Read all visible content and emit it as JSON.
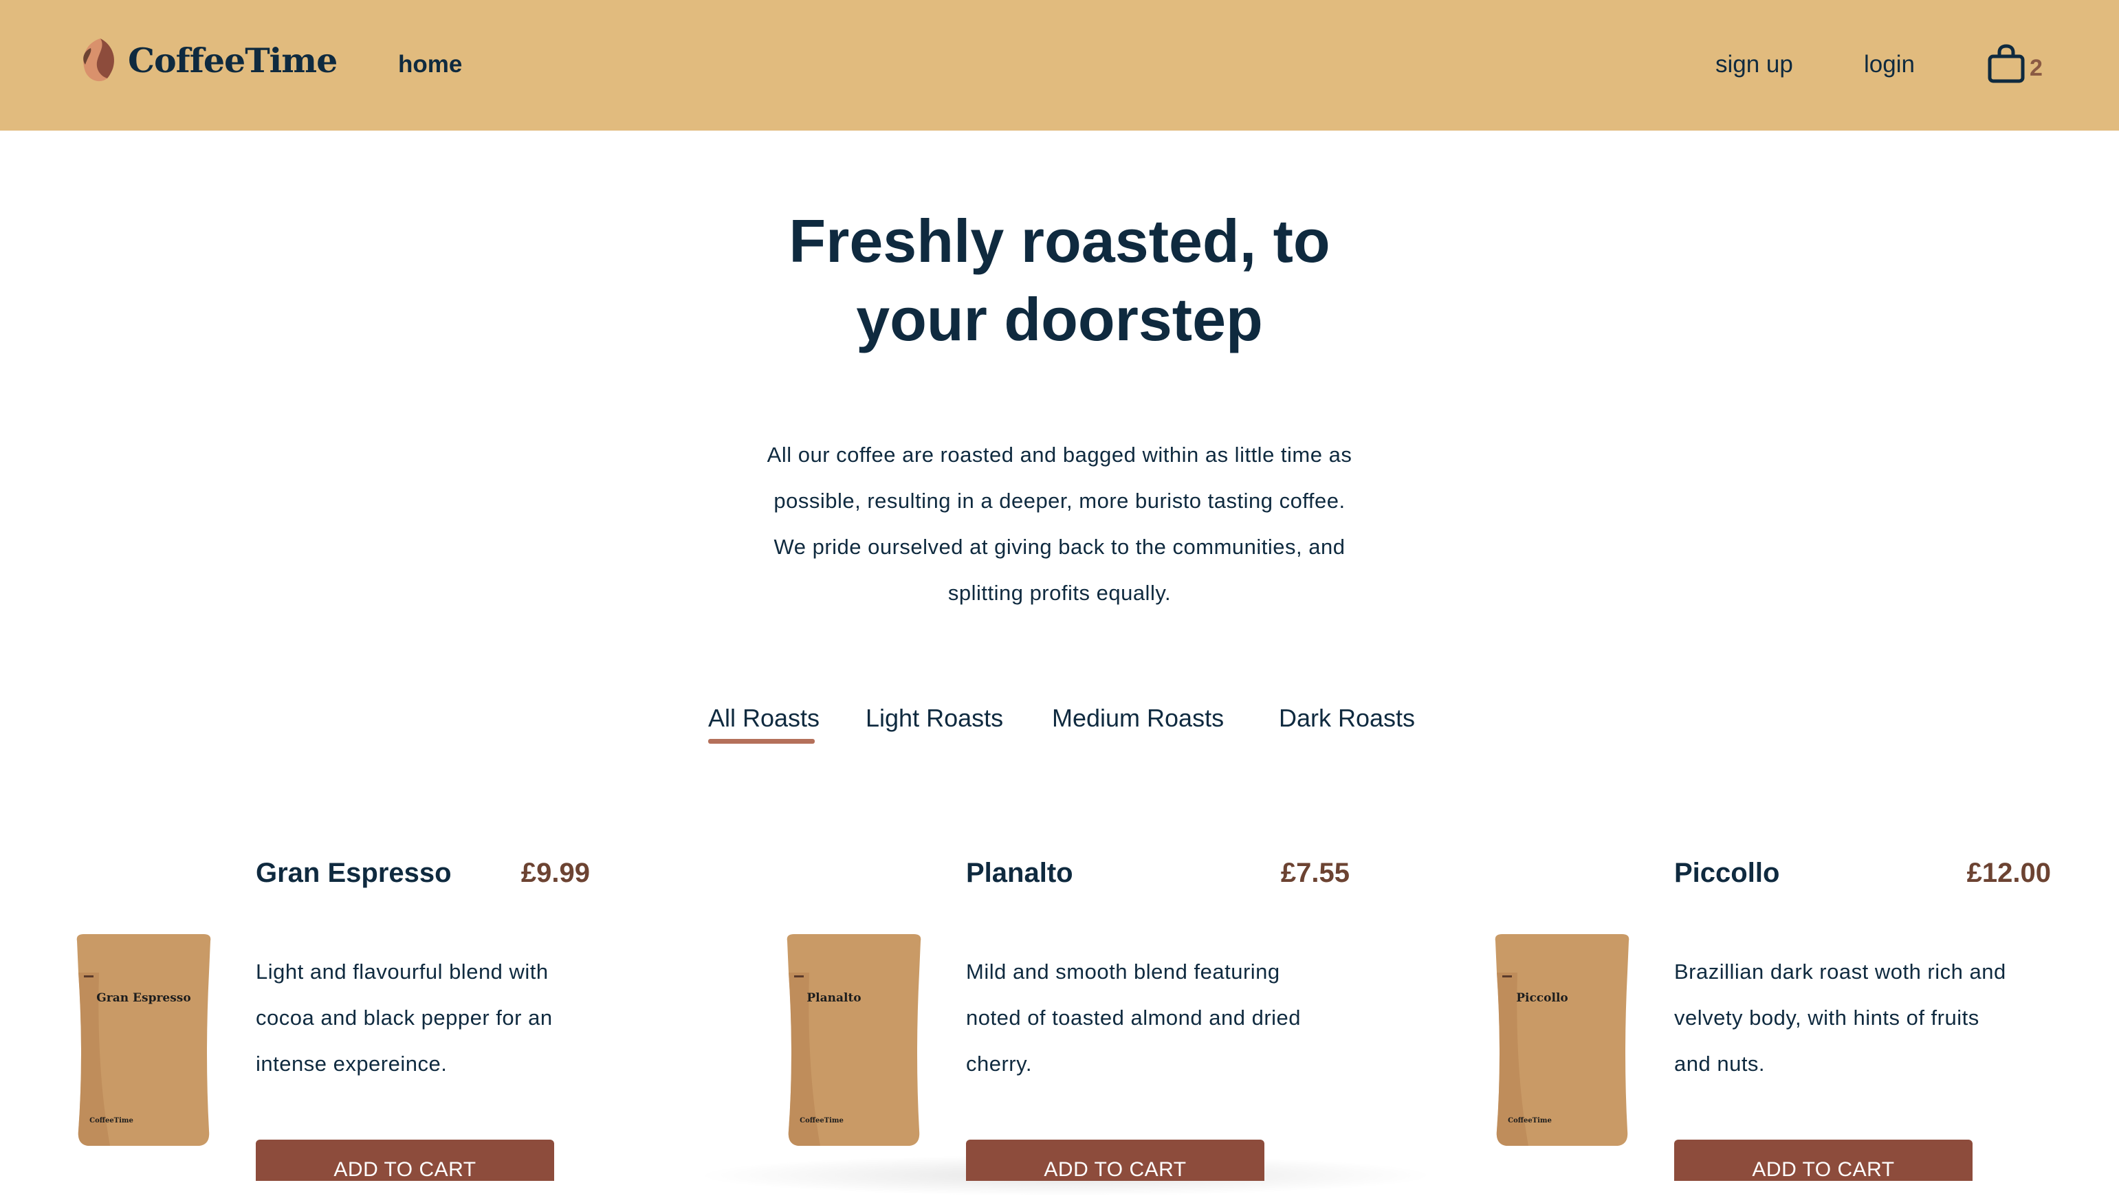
{
  "brand": {
    "name": "CoffeeTime"
  },
  "nav": {
    "home": "home",
    "signup": "sign up",
    "login": "login",
    "cart_count": "2"
  },
  "hero": {
    "title_lines": [
      "Freshly roasted, to",
      "your doorstep"
    ],
    "description_lines": [
      "All our coffee are roasted and bagged within as little time as",
      "possible, resulting in a deeper, more buristo tasting coffee.",
      "We pride ourselved at giving back to the communities, and",
      "splitting profits equally."
    ]
  },
  "tabs": [
    "All Roasts",
    "Light Roasts",
    "Medium Roasts",
    "Dark Roasts"
  ],
  "active_tab": "All Roasts",
  "products": [
    {
      "name": "Gran Espresso",
      "price": "£9.99",
      "bag_label": "Gran Espresso",
      "bag_brand": "CoffeeTime",
      "description_lines": [
        "Light and flavourful blend with",
        "cocoa and black pepper for an",
        "intense expereince."
      ],
      "button": "ADD TO CART"
    },
    {
      "name": "Planalto",
      "price": "£7.55",
      "bag_label": "Planalto",
      "bag_brand": "CoffeeTime",
      "description_lines": [
        "Mild and smooth blend featuring",
        "noted of toasted almond and dried",
        "cherry."
      ],
      "button": "ADD TO CART"
    },
    {
      "name": "Piccollo",
      "price": "£12.00",
      "bag_label": "Piccollo",
      "bag_brand": "CoffeeTime",
      "description_lines": [
        "Brazillian dark roast woth rich and",
        "velvety body, with hints of fruits",
        "and nuts."
      ],
      "button": "ADD TO CART"
    }
  ],
  "icons": {
    "logo": "coffee-bean-icon",
    "cart": "shopping-bag-icon"
  },
  "colors": {
    "header_bg": "#e1bb7e",
    "text_primary": "#0f2a3f",
    "price": "#6c4332",
    "button_bg": "#8d4c3c",
    "tab_underline": "#b4705a",
    "bag_kraft": "#c99a66"
  }
}
